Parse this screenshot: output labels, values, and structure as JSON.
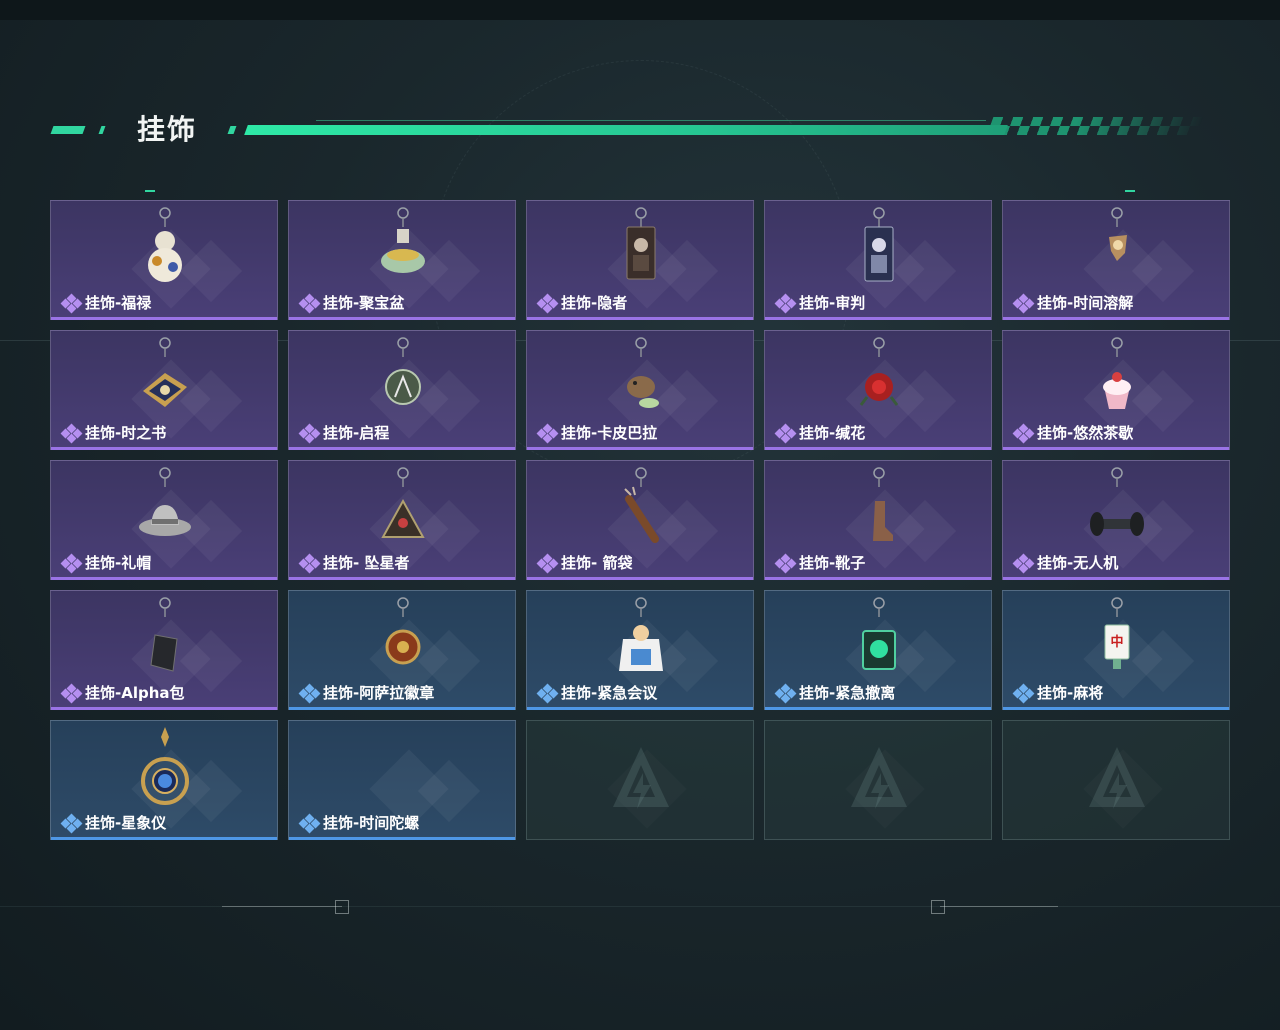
{
  "header": {
    "title": "挂饰"
  },
  "items": [
    {
      "label": "挂饰-福禄",
      "rarity": "purple",
      "icon": "gourd-charm-icon"
    },
    {
      "label": "挂饰-聚宝盆",
      "rarity": "purple",
      "icon": "treasure-bowl-charm-icon"
    },
    {
      "label": "挂饰-隐者",
      "rarity": "purple",
      "icon": "hermit-card-charm-icon"
    },
    {
      "label": "挂饰-审判",
      "rarity": "purple",
      "icon": "judgement-card-charm-icon"
    },
    {
      "label": "挂饰-时间溶解",
      "rarity": "purple",
      "icon": "melting-clock-charm-icon"
    },
    {
      "label": "挂饰-时之书",
      "rarity": "purple",
      "icon": "book-of-time-charm-icon"
    },
    {
      "label": "挂饰-启程",
      "rarity": "purple",
      "icon": "departure-badge-charm-icon"
    },
    {
      "label": "挂饰-卡皮巴拉",
      "rarity": "purple",
      "icon": "capybara-charm-icon"
    },
    {
      "label": "挂饰-缄花",
      "rarity": "purple",
      "icon": "rose-charm-icon"
    },
    {
      "label": "挂饰-悠然茶歇",
      "rarity": "purple",
      "icon": "cupcake-charm-icon"
    },
    {
      "label": "挂饰-礼帽",
      "rarity": "purple",
      "icon": "fedora-hat-charm-icon"
    },
    {
      "label": "挂饰- 坠星者",
      "rarity": "purple",
      "icon": "triangle-emblem-charm-icon"
    },
    {
      "label": "挂饰- 箭袋",
      "rarity": "purple",
      "icon": "quiver-charm-icon"
    },
    {
      "label": "挂饰-靴子",
      "rarity": "purple",
      "icon": "boot-charm-icon"
    },
    {
      "label": "挂饰-无人机",
      "rarity": "purple",
      "icon": "drone-charm-icon"
    },
    {
      "label": "挂饰-Alpha包",
      "rarity": "purple",
      "icon": "alpha-pack-charm-icon"
    },
    {
      "label": "挂饰-阿萨拉徽章",
      "rarity": "blue",
      "icon": "asala-badge-charm-icon"
    },
    {
      "label": "挂饰-紧急会议",
      "rarity": "blue",
      "icon": "emergency-meeting-charm-icon"
    },
    {
      "label": "挂饰-紧急撤离",
      "rarity": "blue",
      "icon": "emergency-evac-charm-icon"
    },
    {
      "label": "挂饰-麻将",
      "rarity": "blue",
      "icon": "mahjong-tile-charm-icon",
      "tile_text": "中"
    },
    {
      "label": "挂饰-星象仪",
      "rarity": "blue",
      "icon": "astrolabe-charm-icon"
    },
    {
      "label": "挂饰-时间陀螺",
      "rarity": "blue",
      "icon": "time-top-charm-icon"
    }
  ],
  "empty_slots": 3,
  "colors": {
    "accent": "#31d6a0",
    "purple_rarity": "#9a73e6",
    "blue_rarity": "#4f97e6"
  }
}
